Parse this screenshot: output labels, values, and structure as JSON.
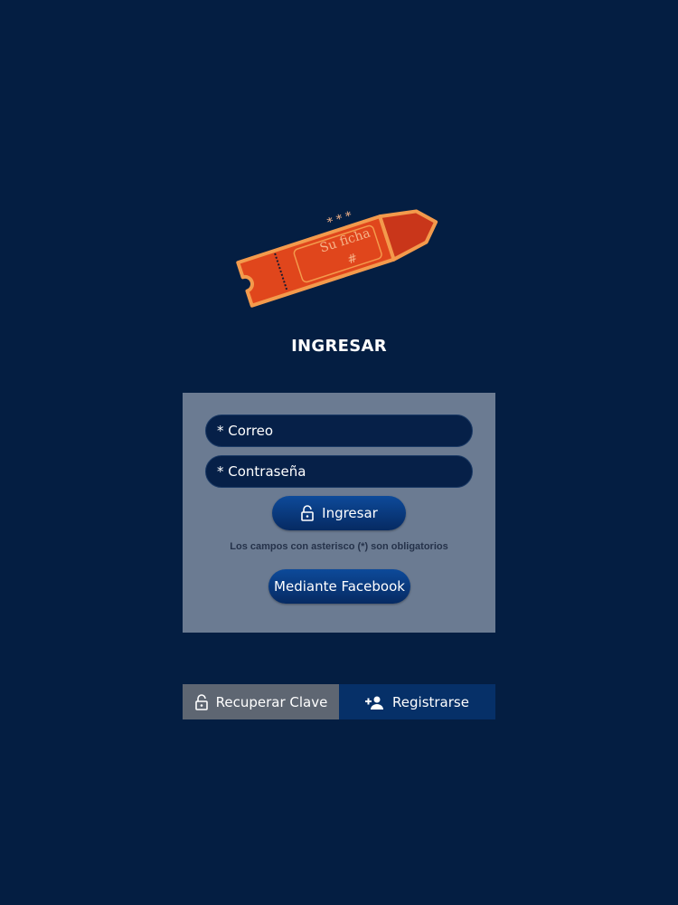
{
  "logo": {
    "line1": "* * *",
    "line2": "Su ficha",
    "line3": "#"
  },
  "title": "INGRESAR",
  "form": {
    "email_placeholder": "* Correo",
    "password_placeholder": "* Contraseña",
    "login_label": "Ingresar",
    "required_note": "Los campos con asterisco (*) son obligatorios",
    "facebook_label": "Mediante Facebook"
  },
  "footer": {
    "recover_label": "Recuperar Clave",
    "register_label": "Registrarse"
  },
  "icons": {
    "login": "lock-icon",
    "recover": "lock-icon",
    "register": "add-user-icon"
  },
  "colors": {
    "background": "#041e42",
    "panel": "#6b7b92",
    "ticket": "#e0461c",
    "ticket_border": "#f39a4c",
    "recover_button": "#5e6672",
    "register_button": "#063068"
  }
}
